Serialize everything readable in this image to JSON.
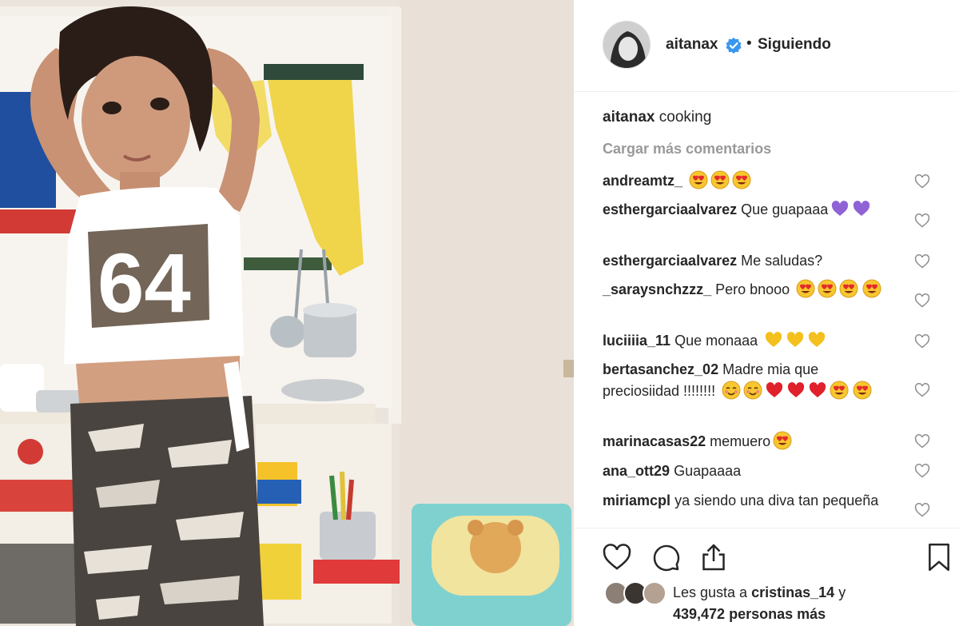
{
  "post": {
    "username": "aitanax",
    "follow_sep": "•",
    "follow_label": "Siguiendo",
    "caption_user": "aitanax",
    "caption_text": "cooking",
    "load_more": "Cargar más comentarios"
  },
  "photo": {
    "shirt_number": "64"
  },
  "comments": [
    {
      "user": "andreamtz_",
      "text": "",
      "emojis": [
        "heart-eyes",
        "heart-eyes",
        "heart-eyes"
      ]
    },
    {
      "user": "esthergarciaalvarez",
      "text": "Que guapaaa",
      "emojis": [
        "purple-heart",
        "purple-heart"
      ]
    },
    {
      "user": "esthergarciaalvarez",
      "text": "Me saludas?",
      "emojis": []
    },
    {
      "user": "_saraysnchzzz_",
      "text": "Pero bnooo",
      "emojis": [
        "heart-eyes",
        "heart-eyes",
        "heart-eyes",
        "heart-eyes"
      ]
    },
    {
      "user": "luciiiia_11",
      "text": "Que monaaa",
      "emojis": [
        "yellow-heart",
        "yellow-heart",
        "yellow-heart"
      ]
    },
    {
      "user": "bertasanchez_02",
      "text": "Madre mia que preciosiidad !!!!!!!!",
      "emojis": [
        "smiling-blush",
        "smiling-blush",
        "red-heart",
        "red-heart",
        "red-heart",
        "heart-eyes",
        "heart-eyes"
      ]
    },
    {
      "user": "marinacasas22",
      "text": "memuero",
      "emojis": [
        "heart-eyes"
      ]
    },
    {
      "user": "ana_ott29",
      "text": "Guapaaaa",
      "emojis": []
    },
    {
      "user": "miriamcpl",
      "text": "ya siendo una diva tan pequeña",
      "emojis": []
    }
  ],
  "likes": {
    "prefix": "Les gusta a",
    "user": "cristinas_14",
    "conj": "y",
    "count": "439,472",
    "suffix": "personas más"
  },
  "icons": [
    "verified-badge-icon",
    "like-heart-icon",
    "comment-icon",
    "share-icon",
    "bookmark-icon",
    "comment-like-heart-icon"
  ],
  "colors": {
    "verified": "#3897f0",
    "muted": "#999999",
    "text": "#262626"
  }
}
